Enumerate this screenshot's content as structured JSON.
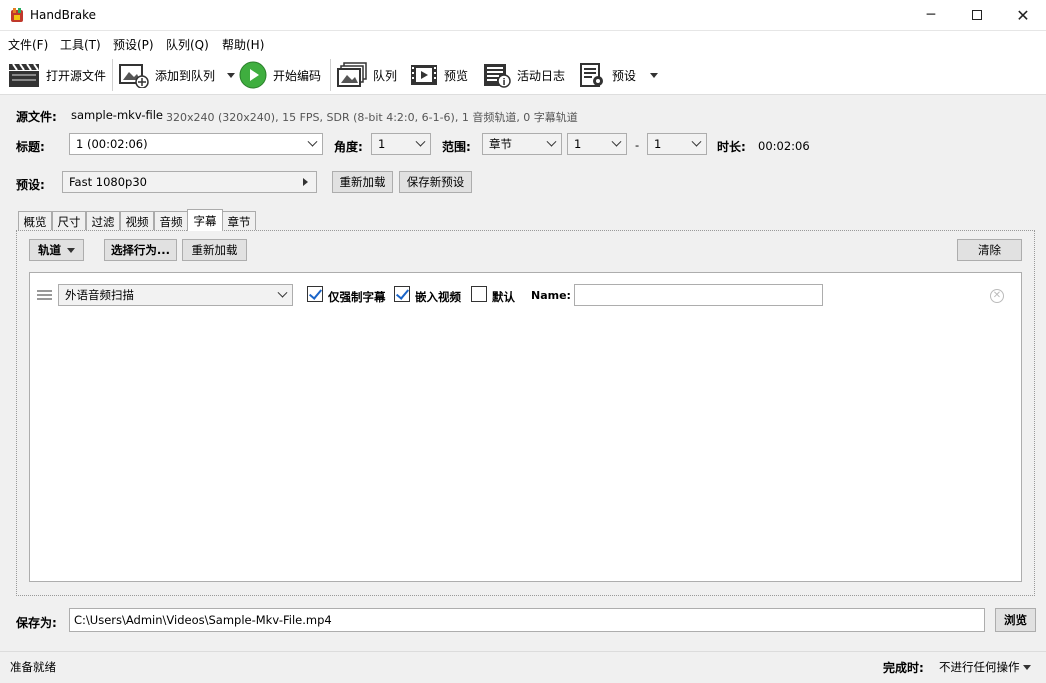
{
  "window": {
    "title": "HandBrake"
  },
  "menu": [
    "文件(F)",
    "工具(T)",
    "预设(P)",
    "队列(Q)",
    "帮助(H)"
  ],
  "toolbar": {
    "open_source": "打开源文件",
    "add_to_queue": "添加到队列",
    "start_encode": "开始编码",
    "queue": "队列",
    "preview": "预览",
    "activity_log": "活动日志",
    "presets": "预设"
  },
  "source": {
    "label": "源文件:",
    "name": "sample-mkv-file",
    "info": "320x240 (320x240), 15 FPS, SDR (8-bit 4:2:0, 6-1-6), 1 音频轨道, 0 字幕轨道"
  },
  "title_row": {
    "title_label": "标题:",
    "title_value": "1  (00:02:06)",
    "angle_label": "角度:",
    "angle_value": "1",
    "range_label": "范围:",
    "range_type": "章节",
    "range_start": "1",
    "range_dash": "-",
    "range_end": "1",
    "duration_label": "时长:",
    "duration_value": "00:02:06"
  },
  "preset_row": {
    "label": "预设:",
    "value": "Fast 1080p30",
    "reload": "重新加载",
    "save_new": "保存新预设"
  },
  "tabs": [
    "概览",
    "尺寸",
    "过滤",
    "视频",
    "音频",
    "字幕",
    "章节"
  ],
  "active_tab": "字幕",
  "subtitles": {
    "tracks_button": "轨道",
    "choose_behavior": "选择行为...",
    "reload": "重新加载",
    "clear": "清除",
    "row": {
      "track": "外语音频扫描",
      "forced_only": "仅强制字幕",
      "forced_only_checked": true,
      "burn_in": "嵌入视频",
      "burn_in_checked": true,
      "default": "默认",
      "default_checked": false,
      "name_label": "Name:",
      "name_value": ""
    }
  },
  "save_as": {
    "label": "保存为:",
    "path": "C:\\Users\\Admin\\Videos\\Sample-Mkv-File.mp4",
    "browse": "浏览"
  },
  "status": {
    "text": "准备就绪",
    "when_done_label": "完成时:",
    "when_done_value": "不进行任何操作"
  },
  "colors": {
    "accent_check": "#1a64c8",
    "play_green": "#3fae3f"
  }
}
